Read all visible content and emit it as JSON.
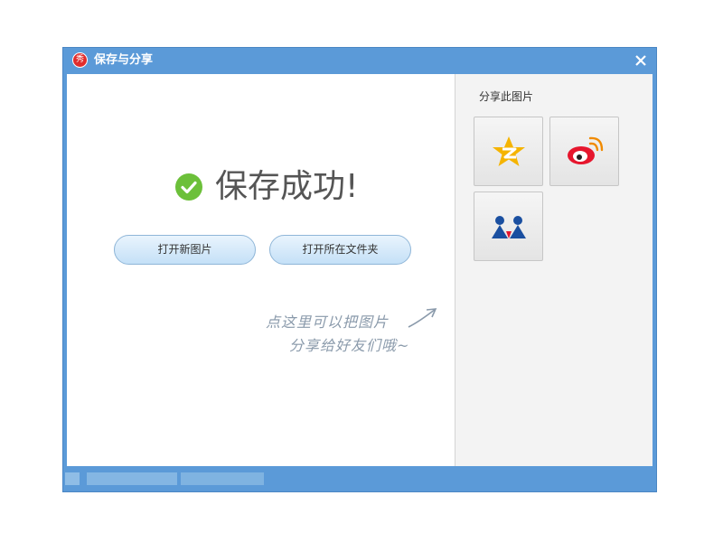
{
  "window": {
    "title": "保存与分享",
    "logo_char": "秀",
    "close_label": "×"
  },
  "main": {
    "success_text": "保存成功!",
    "open_new_label": "打开新图片",
    "open_folder_label": "打开所在文件夹",
    "hint_line1": "点这里可以把图片",
    "hint_line2": "分享给好友们哦~"
  },
  "share": {
    "title": "分享此图片",
    "targets": [
      "qzone-icon",
      "weibo-icon",
      "renren-icon"
    ]
  },
  "colors": {
    "title_bar": "#5b9ad8",
    "success_check": "#6cc03a",
    "button_bg": "#c4e0f7",
    "qzone": "#f5b400",
    "weibo": "#e6162d",
    "renren": "#1a4fa0"
  }
}
